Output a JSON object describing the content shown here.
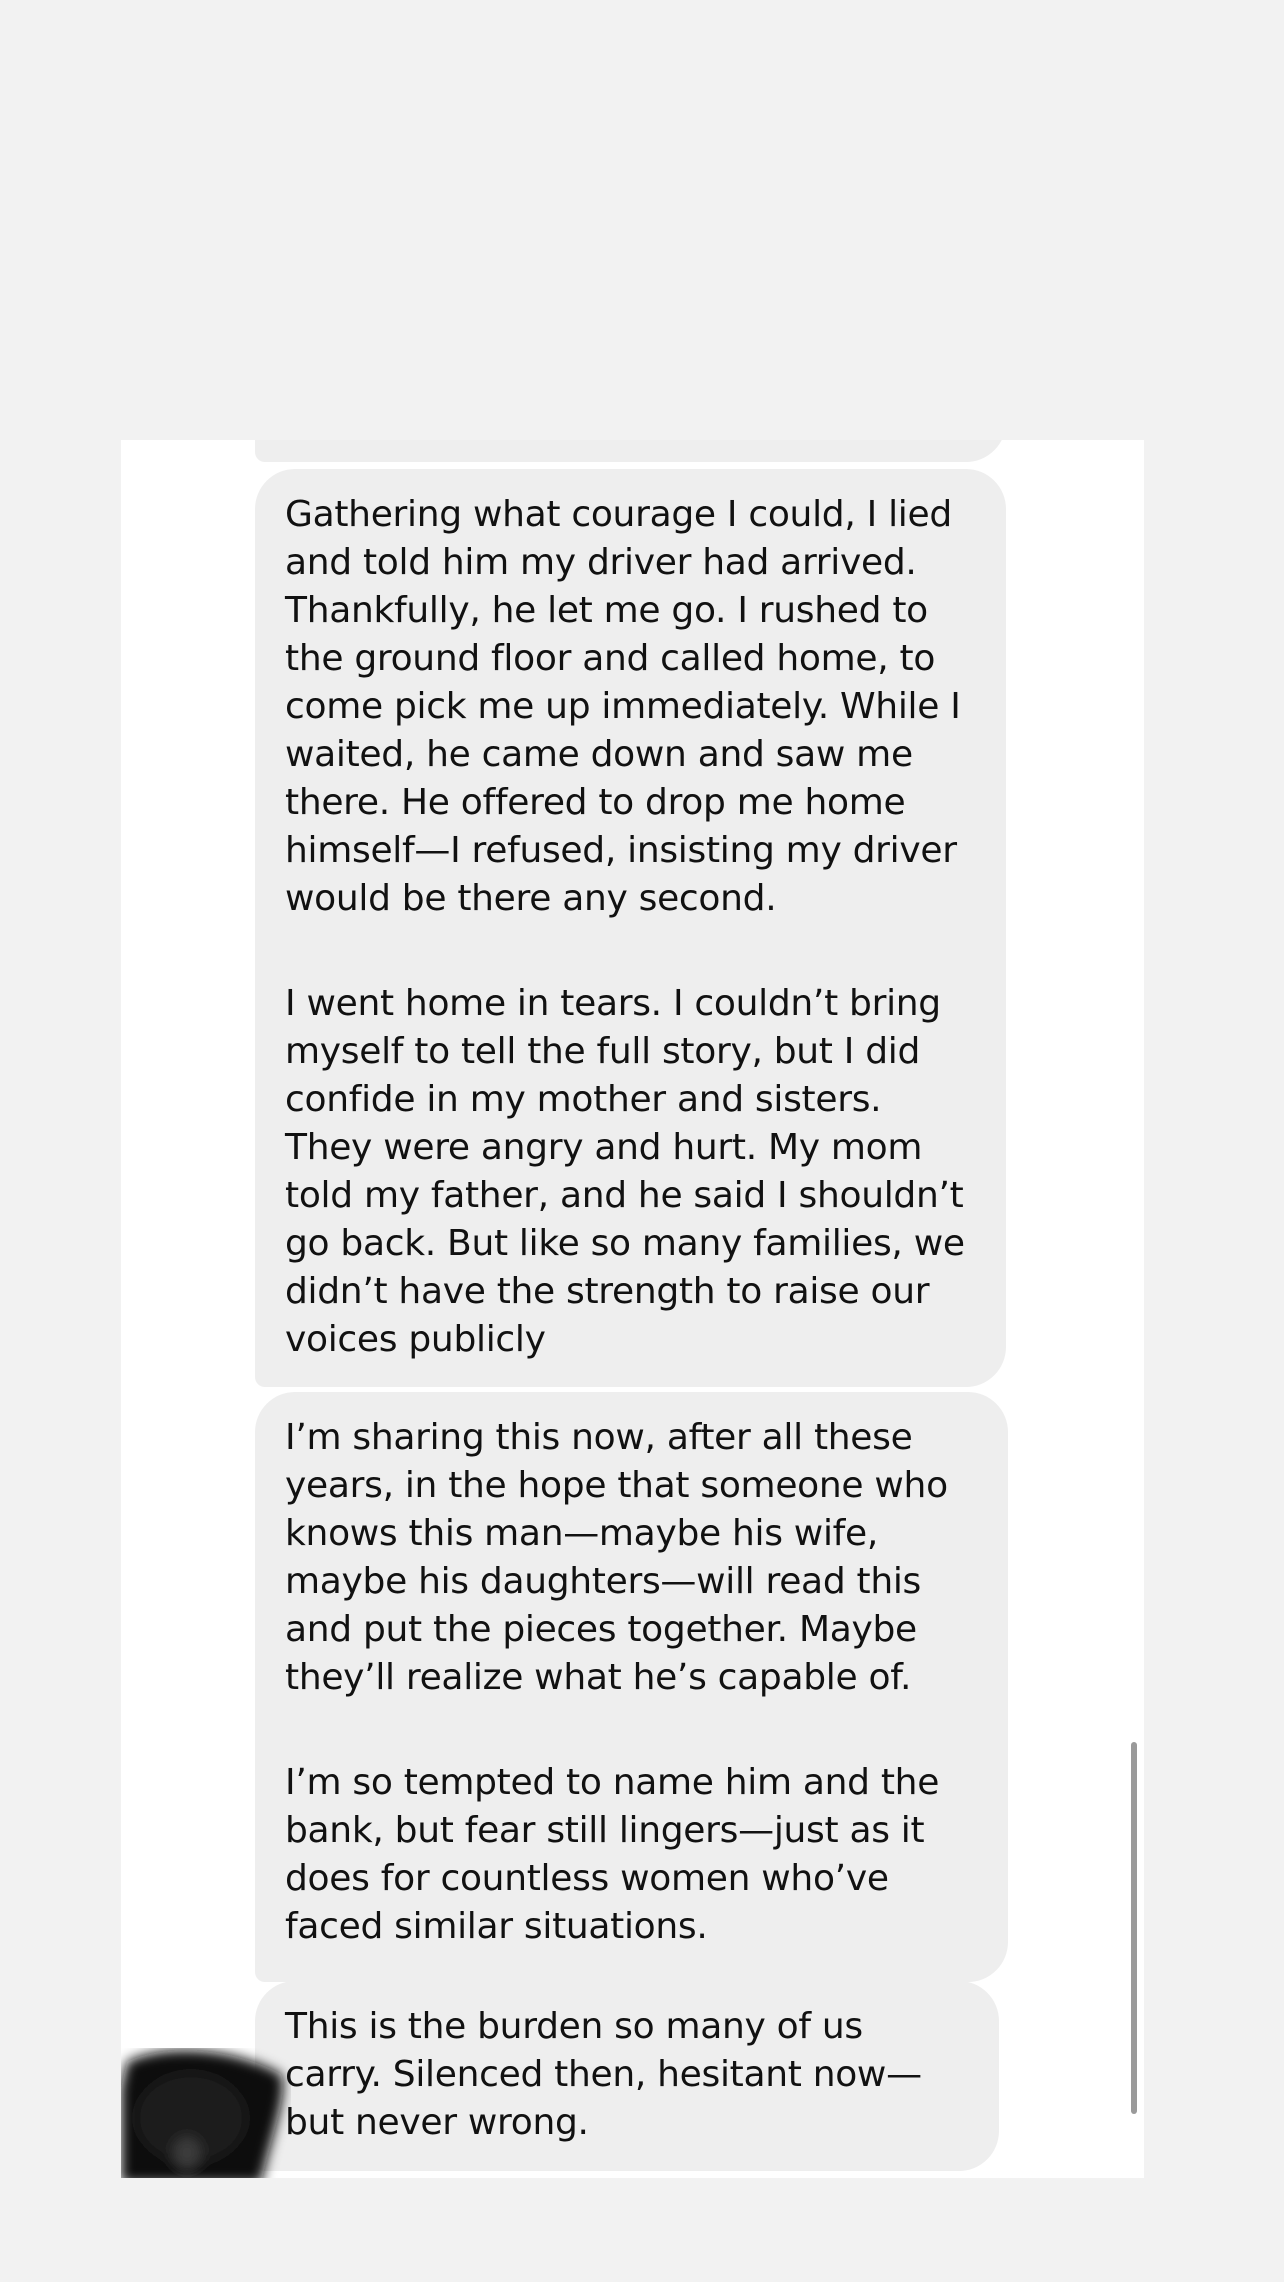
{
  "messages": [
    {
      "paragraphs": [
        "Gathering what courage I could, I lied and told him my driver had arrived. Thankfully, he let me go. I rushed to the ground floor and called home,  to come pick me up immediately. While I waited, he came down and saw me there. He offered to drop me home himself—I refused, insisting my driver would be there any second.",
        "I went home in tears. I couldn’t bring myself to tell the full story, but I did confide in my mother and sisters. They were angry and hurt. My mom told my father, and he said I shouldn’t go back. But like so many families, we didn’t have the strength to raise our voices publicly"
      ]
    },
    {
      "paragraphs": [
        "I’m sharing this now, after all these years, in the hope that someone who knows this man—maybe his wife, maybe his daughters—will read this and put the pieces together. Maybe they’ll realize what he’s capable of.",
        "I’m so tempted to name him and the bank, but fear still lingers—just as it does for countless women who’ve faced similar situations."
      ]
    },
    {
      "paragraphs": [
        "This is the burden so many of us carry. Silenced then, hesitant now—but never wrong."
      ]
    }
  ],
  "colors": {
    "page_background": "#f2f2f2",
    "panel_background": "#ffffff",
    "bubble_background": "#eeeeee",
    "text": "#111111",
    "scrollbar": "#9a9a9a",
    "avatar_blur": "#0b0b0b"
  },
  "icons": {
    "avatar": "blurred-avatar"
  }
}
